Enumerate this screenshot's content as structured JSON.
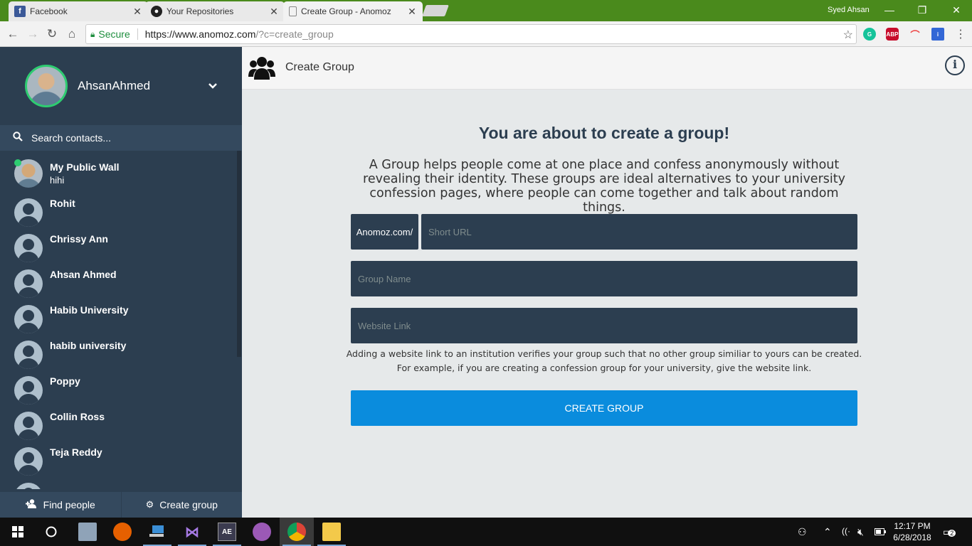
{
  "browser": {
    "tabs": [
      {
        "title": "Facebook",
        "icon": "facebook-icon"
      },
      {
        "title": "Your Repositories",
        "icon": "github-icon"
      },
      {
        "title": "Create Group - Anomoz",
        "icon": "page-icon"
      }
    ],
    "window_user": "Syed Ahsan",
    "secure_label": "Secure",
    "url_host": "https://www.anomoz.com",
    "url_path": "/?c=create_group",
    "accent_color": "#4a8a1c"
  },
  "sidebar": {
    "user_name": "AhsanAhmed",
    "search_placeholder": "Search contacts...",
    "contacts": [
      {
        "name": "My Public Wall",
        "status": "hihi"
      },
      {
        "name": "Rohit"
      },
      {
        "name": "Chrissy Ann"
      },
      {
        "name": "Ahsan Ahmed"
      },
      {
        "name": "Habib University"
      },
      {
        "name": "habib university"
      },
      {
        "name": "Poppy"
      },
      {
        "name": "Collin Ross"
      },
      {
        "name": "Teja Reddy"
      }
    ],
    "footer": {
      "find_people": "Find people",
      "create_group": "Create group"
    }
  },
  "main": {
    "page_title": "Create Group",
    "headline": "You are about to create a group!",
    "description": "A Group helps people come at one place and confess anonymously without revealing their identity. These groups are ideal alternatives to your university confession pages, where people can come together and talk about random things.",
    "url_prefix": "Anomoz.com/",
    "short_url_placeholder": "Short URL",
    "group_name_placeholder": "Group Name",
    "website_link_placeholder": "Website Link",
    "note_line1": "Adding a website link to an institution verifies your group such that no other group similiar to yours can be created.",
    "note_line2": "For example, if you are creating a confession group for your university, give the website link.",
    "create_button": "CREATE GROUP",
    "button_color": "#0a8cdd"
  },
  "taskbar": {
    "time": "12:17 PM",
    "date": "6/28/2018",
    "notifications": "2"
  }
}
